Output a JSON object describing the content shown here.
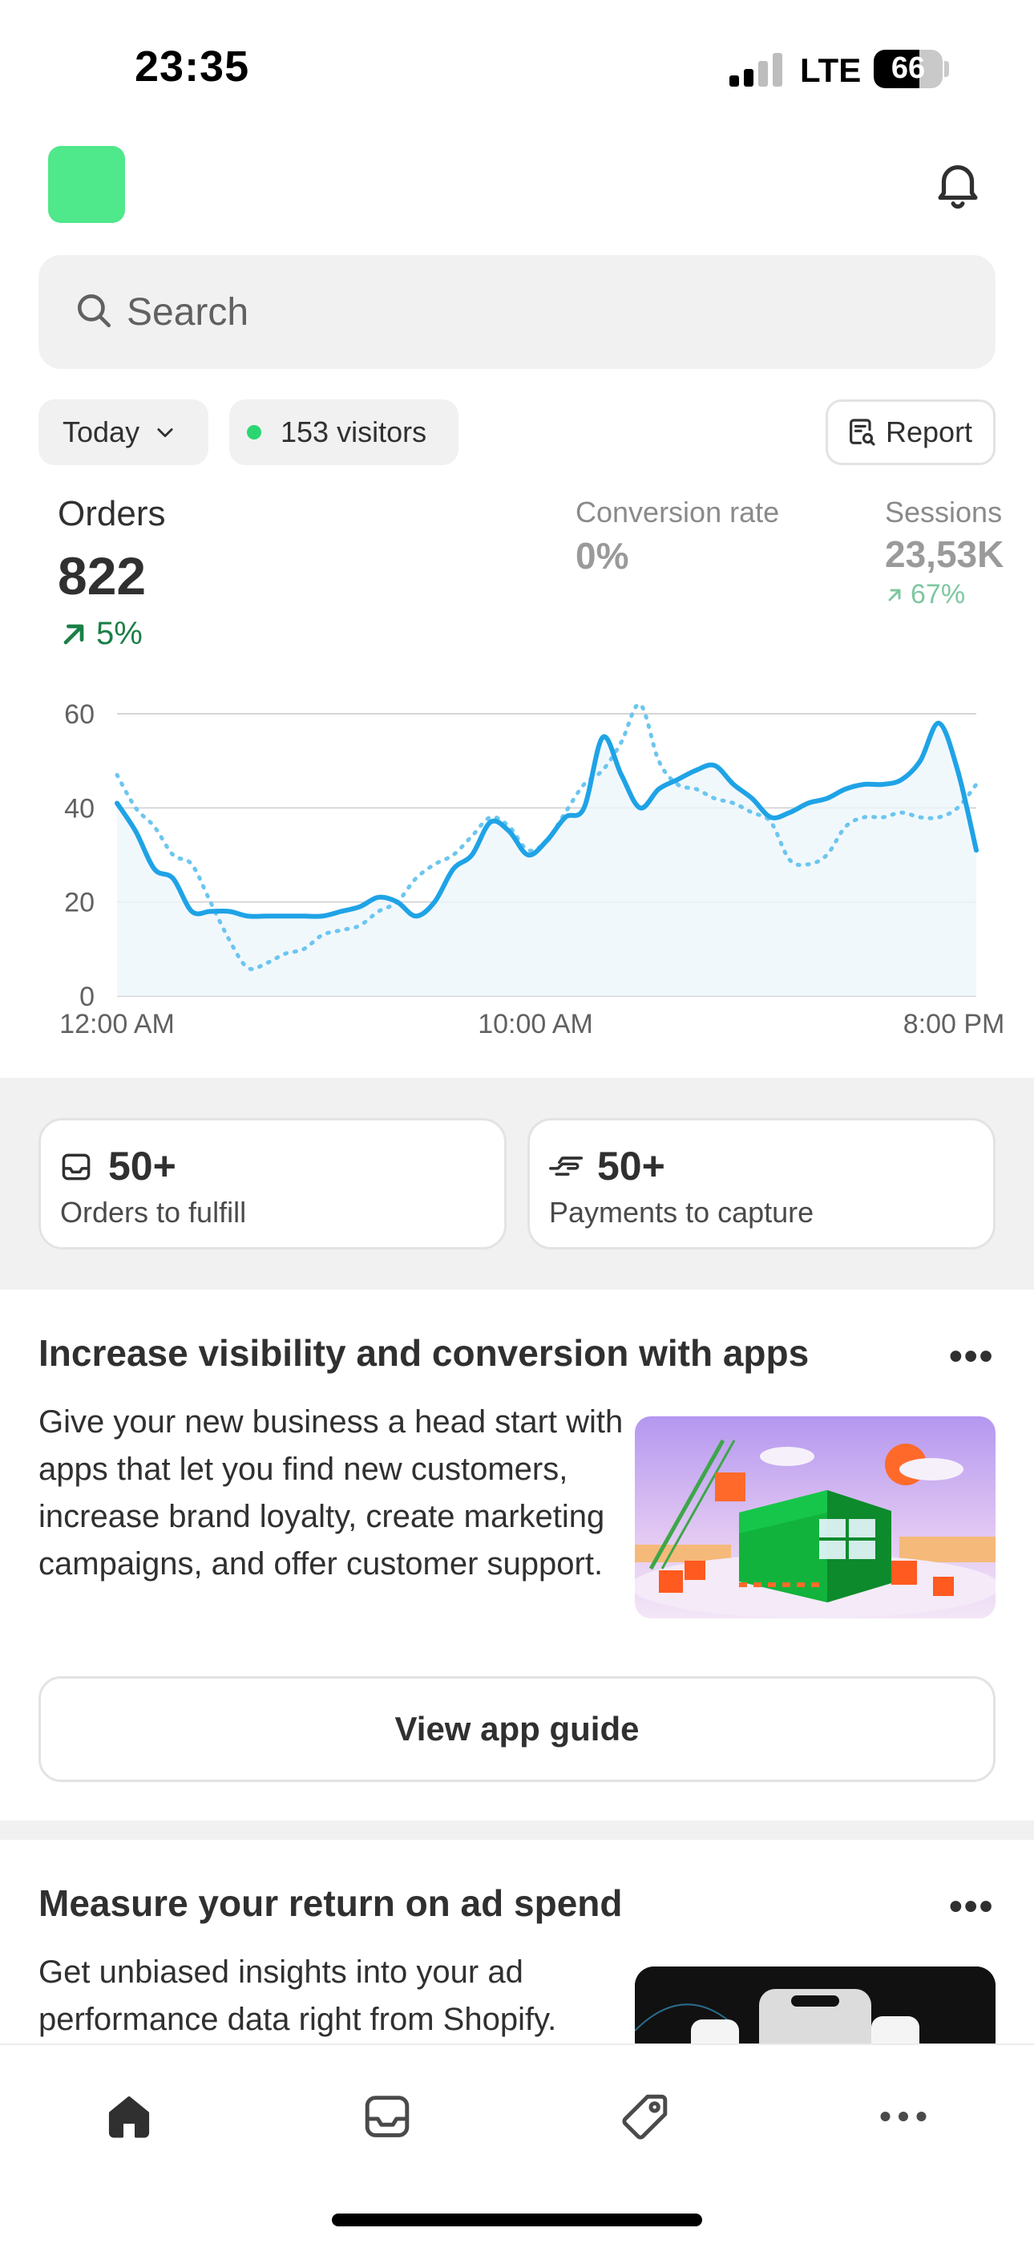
{
  "status_bar": {
    "time": "23:35",
    "network": "LTE",
    "battery": "66",
    "battery_level": 0.66
  },
  "header": {
    "logo": "store-logo",
    "bell": "bell-icon"
  },
  "search": {
    "placeholder": "Search",
    "icon": "search-icon"
  },
  "filters": {
    "date": {
      "label": "Today",
      "icon": "chevron-down-icon"
    },
    "visitors": {
      "label": "153 visitors",
      "dot_color": "#2bd672"
    },
    "report": {
      "label": "Report",
      "icon": "report-icon"
    }
  },
  "metrics": {
    "orders": {
      "label": "Orders",
      "value": "822",
      "change": "5%",
      "change_color": "#1a7f47"
    },
    "conversion": {
      "label": "Conversion rate",
      "value": "0%"
    },
    "sessions": {
      "label": "Sessions",
      "value": "23,53K",
      "change": "67%"
    }
  },
  "chart_data": {
    "type": "line",
    "title": "",
    "ylim": [
      0,
      60
    ],
    "y_ticks": [
      "60",
      "40",
      "20",
      "0"
    ],
    "x_ticks": [
      "12:00 AM",
      "10:00 AM",
      "8:00 PM"
    ],
    "grid": true,
    "series": [
      {
        "style": "solid",
        "color": "#1fa3e6",
        "x": [
          0,
          0.5,
          1,
          1.5,
          2,
          2.5,
          3,
          3.5,
          4,
          4.5,
          5,
          5.5,
          6,
          6.5,
          7,
          7.5,
          8,
          8.5,
          9,
          9.5,
          10,
          10.5,
          11,
          11.5,
          12,
          12.5,
          13,
          13.5,
          14,
          14.5,
          15,
          15.5,
          16,
          16.5,
          17,
          17.5,
          18,
          18.5,
          19,
          19.5,
          20,
          20.5,
          21,
          21.5,
          22,
          22.5,
          23
        ],
        "values": [
          41,
          35,
          27,
          25,
          18,
          18,
          18,
          17,
          17,
          17,
          17,
          17,
          18,
          19,
          21,
          20,
          17,
          20,
          27,
          30,
          37,
          35,
          30,
          33,
          38,
          40,
          55,
          47,
          40,
          44,
          46,
          48,
          49,
          45,
          42,
          38,
          39,
          41,
          42,
          44,
          45,
          45,
          46,
          50,
          58,
          48,
          31
        ]
      },
      {
        "style": "dotted",
        "color": "#6cc6ef",
        "x": [
          0,
          0.5,
          1,
          1.5,
          2,
          2.5,
          3,
          3.5,
          4,
          4.5,
          5,
          5.5,
          6,
          6.5,
          7,
          7.5,
          8,
          8.5,
          9,
          9.5,
          10,
          10.5,
          11,
          11.5,
          12,
          12.5,
          13,
          13.5,
          14,
          14.5,
          15,
          15.5,
          16,
          16.5,
          17,
          17.5,
          18,
          18.5,
          19,
          19.5,
          20,
          20.5,
          21,
          21.5,
          22,
          22.5,
          23
        ],
        "values": [
          47,
          40,
          36,
          30,
          28,
          20,
          12,
          6,
          7,
          9,
          10,
          13,
          14,
          15,
          18,
          20,
          25,
          28,
          30,
          34,
          38,
          36,
          31,
          33,
          39,
          45,
          48,
          54,
          62,
          50,
          45,
          44,
          42,
          41,
          39,
          37,
          29,
          28,
          30,
          36,
          38,
          38,
          39,
          38,
          38,
          40,
          45
        ]
      }
    ]
  },
  "tasks": [
    {
      "value": "50+",
      "label": "Orders to fulfill",
      "icon": "inbox-icon"
    },
    {
      "value": "50+",
      "label": "Payments to capture",
      "icon": "hand-cash-icon"
    }
  ],
  "promo_apps": {
    "title": "Increase visibility and conversion with apps",
    "more": "•••",
    "body": "Give your new business a head start with apps that let you find new customers, increase brand loyalty, create marketing campaigns, and offer customer support.",
    "button": "View app guide"
  },
  "promo_ads": {
    "title": "Measure your return on ad spend",
    "more": "•••",
    "body": "Get unbiased insights into your ad performance data right from Shopify."
  },
  "tab_bar": [
    {
      "name": "home-icon",
      "active": true
    },
    {
      "name": "orders-inbox-icon",
      "active": false
    },
    {
      "name": "products-tag-icon",
      "active": false
    },
    {
      "name": "more-icon",
      "active": false
    }
  ]
}
